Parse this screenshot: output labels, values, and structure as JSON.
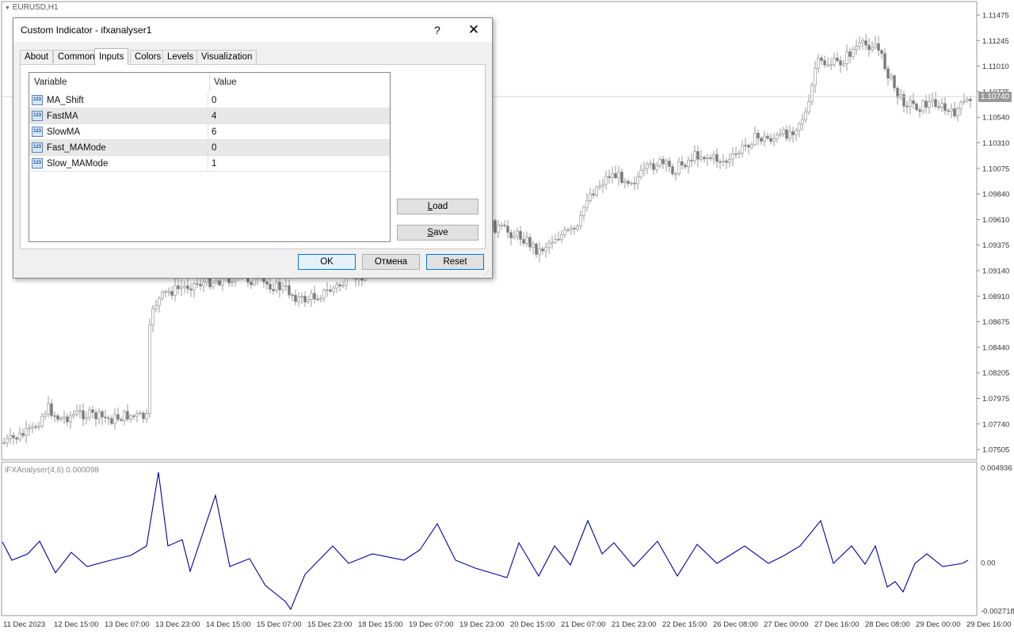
{
  "chart": {
    "symbol_label": "EURUSD,H1",
    "current_price": "1.10740",
    "price_axis": [
      "1.11475",
      "1.11245",
      "1.11010",
      "1.10775",
      "1.10540",
      "1.10310",
      "1.10075",
      "1.09840",
      "1.09610",
      "1.09375",
      "1.09140",
      "1.08910",
      "1.08675",
      "1.08440",
      "1.08205",
      "1.07975",
      "1.07740",
      "1.07505"
    ],
    "time_axis": [
      "11 Dec 2023",
      "12 Dec 15:00",
      "13 Dec 07:00",
      "13 Dec 23:00",
      "14 Dec 15:00",
      "15 Dec 07:00",
      "15 Dec 23:00",
      "18 Dec 15:00",
      "19 Dec 07:00",
      "19 Dec 23:00",
      "20 Dec 15:00",
      "21 Dec 07:00",
      "21 Dec 23:00",
      "22 Dec 15:00",
      "26 Dec 08:00",
      "27 Dec 00:00",
      "27 Dec 16:00",
      "28 Dec 08:00",
      "29 Dec 00:00",
      "29 Dec 16:00"
    ],
    "colors": {
      "candle": "#8c8c8c",
      "indicator_line": "#0000a0",
      "grid_line": "#c8c8c8"
    }
  },
  "indicator": {
    "label": "iFXAnalyser(4,6) 0.000098",
    "axis": [
      "0.004936",
      "0.00",
      "-0.002718"
    ]
  },
  "dialog": {
    "title": "Custom Indicator - ifxanalyser1",
    "help": "?",
    "close": "✕",
    "tabs": [
      "About",
      "Common",
      "Inputs",
      "Colors",
      "Levels",
      "Visualization"
    ],
    "active_tab": "Inputs",
    "columns": {
      "variable": "Variable",
      "value": "Value"
    },
    "icon_text": "123",
    "inputs": [
      {
        "variable": "MA_Shift",
        "value": "0"
      },
      {
        "variable": "FastMA",
        "value": "4"
      },
      {
        "variable": "SlowMA",
        "value": "6"
      },
      {
        "variable": "Fast_MAMode",
        "value": "0"
      },
      {
        "variable": "Slow_MAMode",
        "value": "1"
      }
    ],
    "buttons": {
      "load": {
        "underlined": "L",
        "rest": "oad"
      },
      "save": {
        "underlined": "S",
        "rest": "ave"
      },
      "ok": "OK",
      "cancel": "Отмена",
      "reset": "Reset"
    }
  }
}
